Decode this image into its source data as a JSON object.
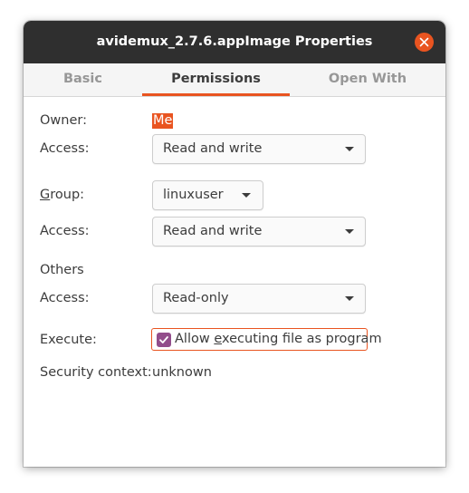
{
  "window": {
    "title": "avidemux_2.7.6.appImage Properties",
    "close_icon": "close-icon",
    "accent_color": "#e95420"
  },
  "tabs": [
    {
      "label": "Basic",
      "active": false
    },
    {
      "label": "Permissions",
      "active": true
    },
    {
      "label": "Open With",
      "active": false
    }
  ],
  "permissions": {
    "owner_label": "Owner:",
    "owner_value": "Me",
    "owner_access_label": "Access:",
    "owner_access_value": "Read and write",
    "group_label_prefix": "",
    "group_label_mnemonic": "G",
    "group_label_rest": "roup:",
    "group_value": "linuxuser",
    "group_access_label": "Access:",
    "group_access_value": "Read and write",
    "others_label": "Others",
    "others_access_label": "Access:",
    "others_access_value": "Read-only",
    "execute_label": "Execute:",
    "execute_checked": true,
    "execute_text_prefix": "Allow ",
    "execute_text_mnemonic": "e",
    "execute_text_rest": "xecuting file as program",
    "security_context_label": "Security context:",
    "security_context_value": "unknown"
  }
}
